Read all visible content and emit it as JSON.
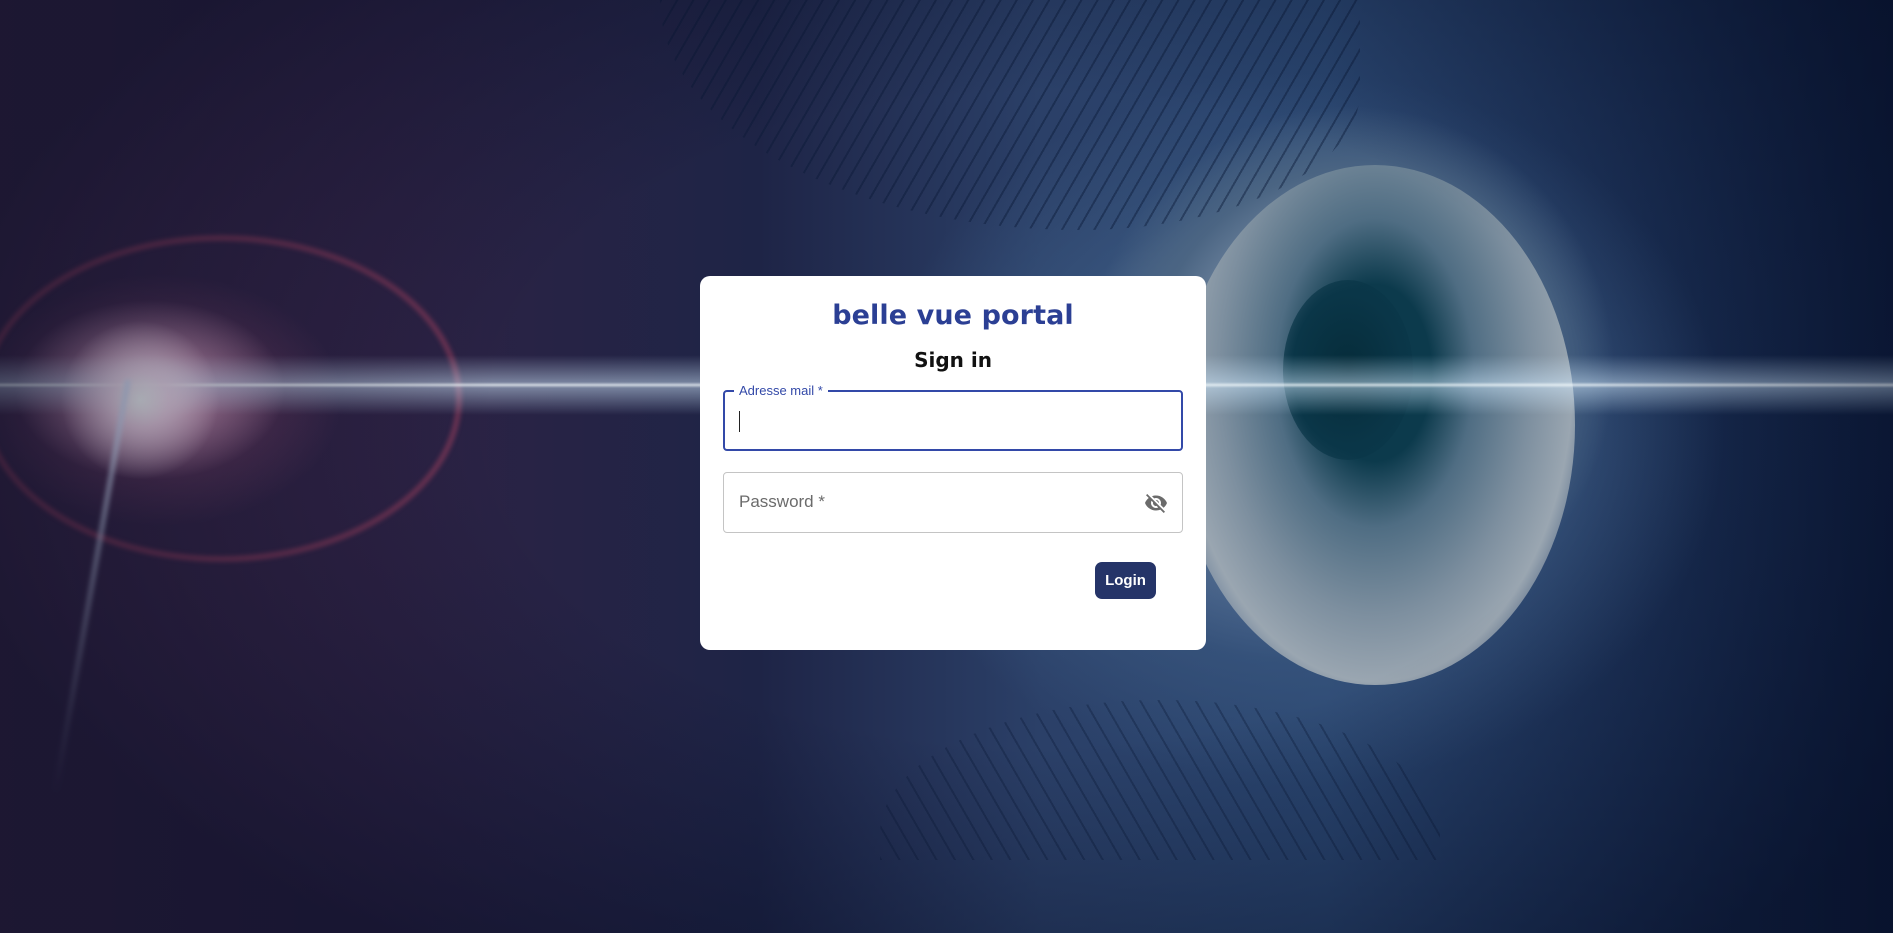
{
  "app": {
    "title": "belle vue portal",
    "heading": "Sign in"
  },
  "email": {
    "label": "Adresse mail *",
    "value": ""
  },
  "password": {
    "placeholder": "Password *",
    "value": "",
    "toggle_icon": "visibility-off-icon"
  },
  "actions": {
    "login_label": "Login"
  },
  "colors": {
    "brand": "#2b3f94",
    "button": "#253468",
    "focus_border": "#3349a8"
  }
}
